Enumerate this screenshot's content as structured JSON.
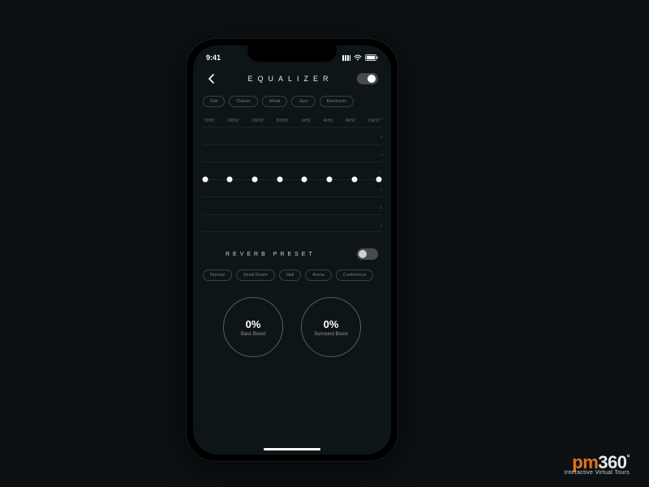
{
  "status": {
    "time": "9:41"
  },
  "header": {
    "title": "EQUALIZER"
  },
  "eq": {
    "presets": [
      "Flat",
      "Classic",
      "Metal",
      "Jazz",
      "Electronic"
    ],
    "freqs": [
      "50HZ",
      "100HZ",
      "200HZ",
      "500HZ",
      "1kHZ",
      "4kHZ",
      "8kHZ",
      "16kHZ"
    ],
    "toggle_on": true,
    "scale": [
      "+9",
      "+6",
      "+3",
      "0",
      "-3",
      "-6",
      "-9"
    ]
  },
  "reverb": {
    "title": "REVERB PRESET",
    "toggle_on": false,
    "presets": [
      "Normal",
      "Small Room",
      "Hall",
      "Arena",
      "Conference"
    ]
  },
  "knobs": {
    "bass": {
      "value": "0%",
      "label": "Bass Boost"
    },
    "surround": {
      "value": "0%",
      "label": "Surround Boost"
    }
  },
  "brand": {
    "name_a": "pm",
    "name_b": "360",
    "deg": "°",
    "tagline": "Interactive Virtual Tours"
  }
}
